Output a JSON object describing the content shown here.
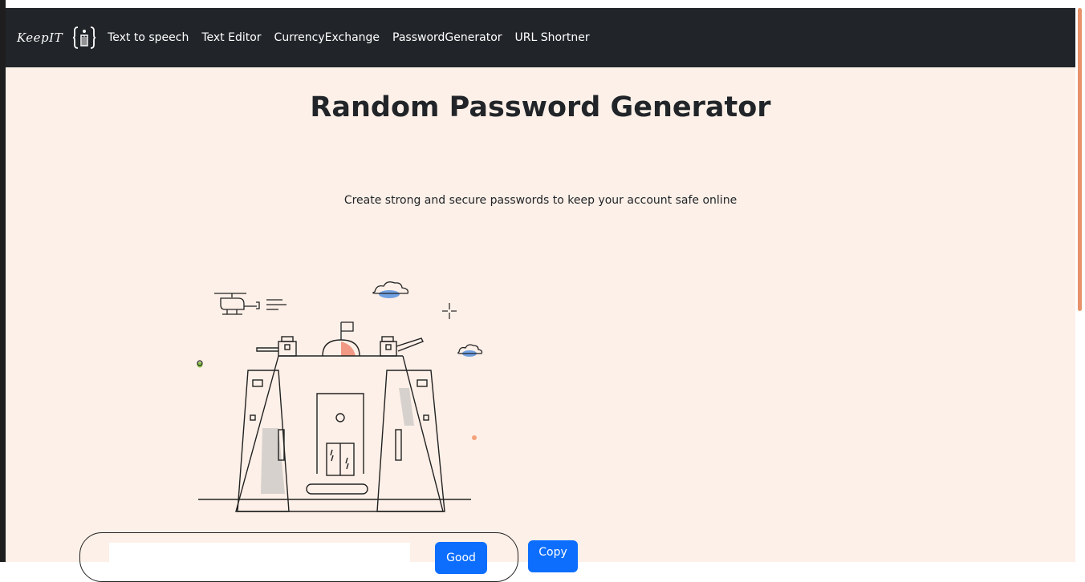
{
  "navbar": {
    "brand": "KeepIT",
    "links": [
      "Text to speech",
      "Text Editor",
      "CurrencyExchange",
      "PasswordGenerator",
      "URL Shortner"
    ]
  },
  "page": {
    "title": "Random Password Generator",
    "subtitle": "Create strong and secure passwords to keep your account safe online"
  },
  "generator": {
    "password_value": "",
    "strength_label": "Good",
    "copy_label": "Copy"
  },
  "colors": {
    "navbar_bg": "#212529",
    "page_bg": "#fdf0e8",
    "button_blue": "#0d6efd",
    "scroll_thumb": "#e8916a"
  }
}
